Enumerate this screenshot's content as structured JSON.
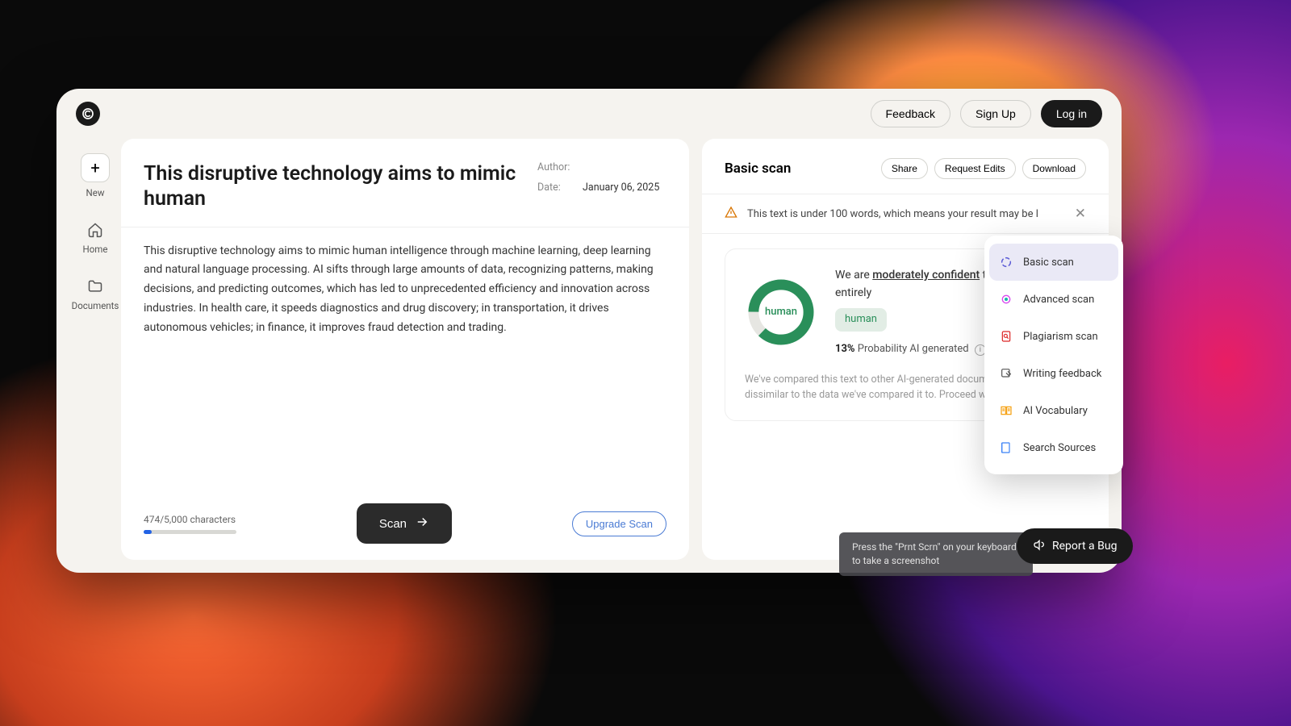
{
  "header": {
    "feedback": "Feedback",
    "signup": "Sign Up",
    "login": "Log in"
  },
  "sidebar": {
    "new": "New",
    "home": "Home",
    "documents": "Documents"
  },
  "doc": {
    "title": "This  disruptive technology aims to mimic human",
    "author_label": "Author:",
    "author_value": "",
    "date_label": "Date:",
    "date_value": "January 06, 2025",
    "body": "This  disruptive technology aims to mimic human intelligence through machine learning, deep learning and natural language processing. AI sifts through large amounts of data,  recognizing patterns, making decisions, and predicting outcomes, which has led to unprecedented efficiency and innovation across industries. In health  care, it speeds diagnostics and drug discovery; in transportation, it drives autonomous vehicles; in finance, it improves fraud detection and trading.",
    "char_count": "474/5,000 characters",
    "scan": "Scan",
    "upgrade": "Upgrade Scan"
  },
  "panel": {
    "title": "Basic scan",
    "share": "Share",
    "request_edits": "Request Edits",
    "download": "Download",
    "warning": "This text is under 100 words, which means your result may be l",
    "result_pre": "We are ",
    "result_conf": "moderately confident",
    "result_post": " this text is entirely",
    "human": "human",
    "prob_pct": "13%",
    "prob_label": " Probability AI generated",
    "compare": "We've compared this text to other AI-generated documents. It's dissimilar to the data we've compared it to. Proceed with caution."
  },
  "chart_data": {
    "type": "pie",
    "title": "",
    "series": [
      {
        "name": "Probability AI generated",
        "value": 13
      },
      {
        "name": "Probability human",
        "value": 87
      }
    ],
    "center_label": "human"
  },
  "menu": {
    "basic": "Basic scan",
    "advanced": "Advanced scan",
    "plagiarism": "Plagiarism scan",
    "writing": "Writing feedback",
    "vocab": "AI Vocabulary",
    "sources": "Search Sources"
  },
  "toast": "Press the \"Prnt Scrn\" on your keyboard to take a screenshot",
  "report_bug": "Report a Bug"
}
